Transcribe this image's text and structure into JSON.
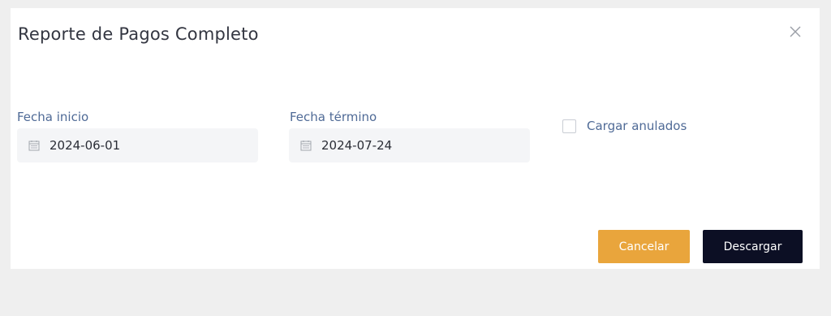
{
  "dialog": {
    "title": "Reporte de Pagos Completo",
    "close_icon": "close-icon"
  },
  "form": {
    "start_date": {
      "label": "Fecha inicio",
      "value": "2024-06-01",
      "icon": "calendar-icon"
    },
    "end_date": {
      "label": "Fecha término",
      "value": "2024-07-24",
      "icon": "calendar-icon"
    },
    "load_cancelled": {
      "label": "Cargar anulados",
      "checked": false
    }
  },
  "actions": {
    "cancel_label": "Cancelar",
    "download_label": "Descargar"
  },
  "colors": {
    "cancel_button": "#e9a53c",
    "download_button": "#0c0f24",
    "label_text": "#4f6a96",
    "input_background": "#f4f5f7",
    "page_background": "#efefef"
  }
}
